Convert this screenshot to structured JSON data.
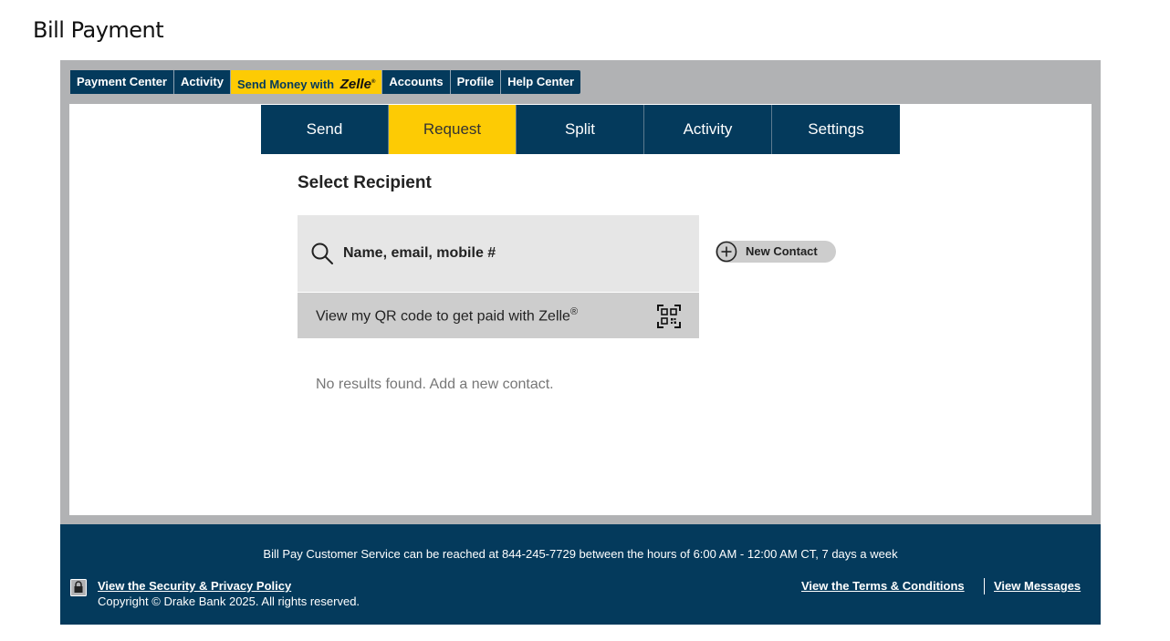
{
  "page": {
    "title": "Bill Payment"
  },
  "topnav": {
    "items": [
      {
        "label": "Payment Center"
      },
      {
        "label": "Activity"
      },
      {
        "label": "Send Money with",
        "logo_text": "Zelle",
        "logo_mark": "®"
      },
      {
        "label": "Accounts"
      },
      {
        "label": "Profile"
      },
      {
        "label": "Help Center"
      }
    ]
  },
  "subtabs": [
    {
      "label": "Send"
    },
    {
      "label": "Request"
    },
    {
      "label": "Split"
    },
    {
      "label": "Activity"
    },
    {
      "label": "Settings"
    }
  ],
  "main": {
    "section_title": "Select Recipient",
    "search": {
      "placeholder": "Name, email, mobile #",
      "value": ""
    },
    "qr": {
      "label": "View my QR code to get paid with Zelle",
      "mark": "®"
    },
    "new_contact_label": "New Contact",
    "no_results": "No results found. Add a new contact."
  },
  "footer": {
    "service_note": "Bill Pay Customer Service can be reached at 844-245-7729 between the hours of 6:00 AM - 12:00 AM CT, 7 days a week",
    "security_link": "View the Security & Privacy Policy",
    "copyright": "Copyright © Drake Bank 2025. All rights reserved.",
    "terms_link": "View the Terms & Conditions",
    "messages_link": "View Messages"
  },
  "colors": {
    "navy": "#043a5c",
    "zelle_yellow": "#fdcb04",
    "frame_gray": "#b1b2b4",
    "search_bg": "#e6e6e6",
    "qr_bg": "#cdcdcd"
  },
  "icons": [
    "search-icon",
    "qr-code-icon",
    "plus-circle-icon",
    "lock-icon"
  ]
}
